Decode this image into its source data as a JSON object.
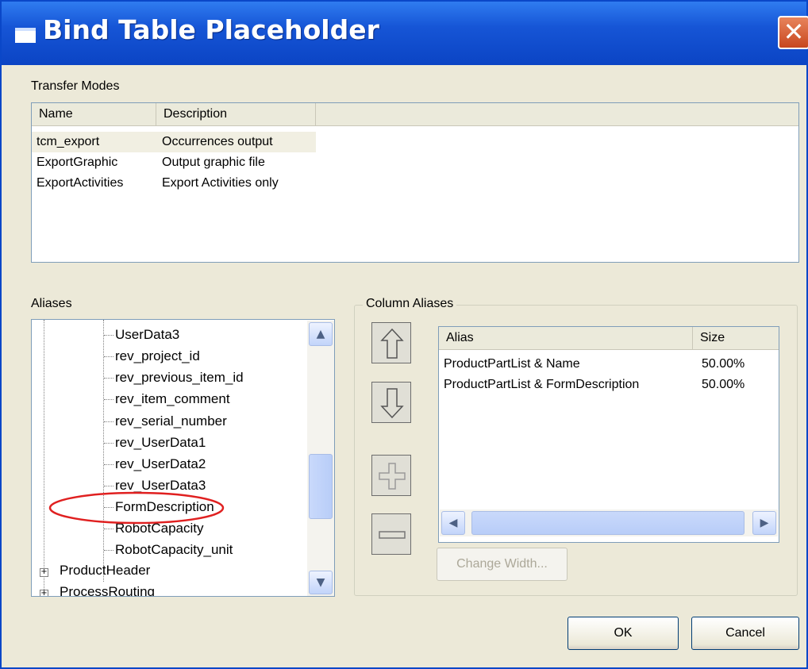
{
  "window": {
    "title": "Bind Table Placeholder",
    "close_glyph": "✕"
  },
  "transfer_modes": {
    "label": "Transfer Modes",
    "columns": [
      "Name",
      "Description"
    ],
    "rows": [
      {
        "name": "tcm_export",
        "description": "Occurrences output"
      },
      {
        "name": "ExportGraphic",
        "description": "Output graphic file"
      },
      {
        "name": "ExportActivities",
        "description": "Export Activities only"
      }
    ]
  },
  "aliases": {
    "label": "Aliases",
    "items": [
      "UserData3",
      "rev_project_id",
      "rev_previous_item_id",
      "rev_item_comment",
      "rev_serial_number",
      "rev_UserData1",
      "rev_UserData2",
      "rev_UserData3",
      "FormDescription",
      "RobotCapacity",
      "RobotCapacity_unit"
    ],
    "nodes": [
      "ProductHeader",
      "ProcessRouting"
    ],
    "highlighted": "FormDescription",
    "highlight_color": "#e02020"
  },
  "column_aliases": {
    "label": "Column Aliases",
    "columns": [
      "Alias",
      "Size"
    ],
    "rows": [
      {
        "alias": "ProductPartList & Name",
        "size": "50.00%"
      },
      {
        "alias": "ProductPartList & FormDescription",
        "size": "50.00%"
      }
    ],
    "change_width_label": "Change Width..."
  },
  "buttons": {
    "ok": "OK",
    "cancel": "Cancel"
  },
  "colors": {
    "titlebar": "#0b44c4",
    "dialog_bg": "#ece9d8",
    "list_border": "#7f9db9"
  }
}
